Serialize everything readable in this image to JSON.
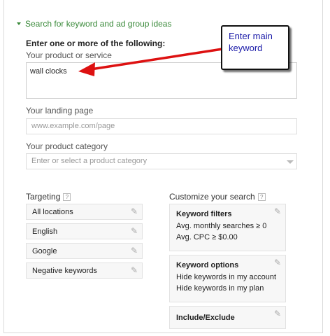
{
  "section": {
    "title": "Search for keyword and ad group ideas"
  },
  "form": {
    "intro": "Enter one or more of the following:",
    "product_label": "Your product or service",
    "product_value": "wall clocks",
    "landing_label": "Your landing page",
    "landing_placeholder": "www.example.com/page",
    "category_label": "Your product category",
    "category_placeholder": "Enter or select a product category"
  },
  "targeting": {
    "title": "Targeting",
    "help": "?",
    "items": [
      "All locations",
      "English",
      "Google",
      "Negative keywords"
    ]
  },
  "customize": {
    "title": "Customize your search",
    "help": "?",
    "keyword_filters": {
      "title": "Keyword filters",
      "lines": [
        "Avg. monthly searches ≥ 0",
        "Avg. CPC ≥ $0.00"
      ]
    },
    "keyword_options": {
      "title": "Keyword options",
      "lines": [
        "Hide keywords in my account",
        "Hide keywords in my plan"
      ]
    },
    "include_exclude": {
      "title": "Include/Exclude"
    }
  },
  "annotation": {
    "text": "Enter main keyword",
    "text_color": "#1a1aa8",
    "arrow_color": "#dd1111"
  },
  "colors": {
    "section_green": "#3a8a3a"
  },
  "icons": {
    "edit": "pencil-icon",
    "collapse": "caret-down-icon",
    "help": "help-icon"
  }
}
